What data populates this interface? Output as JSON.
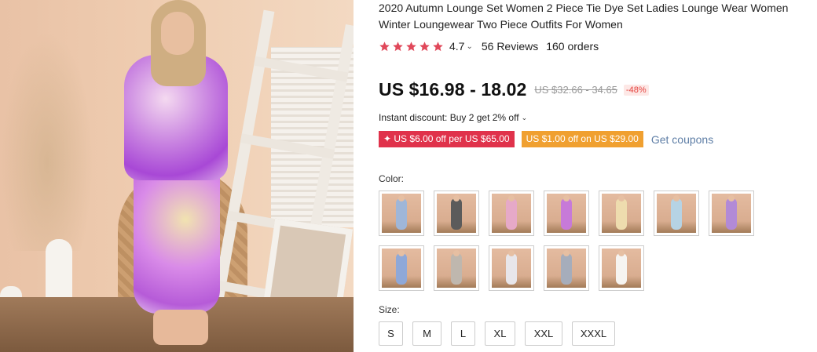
{
  "product": {
    "title": "2020 Autumn Lounge Set Women 2 Piece Tie Dye Set Ladies Lounge Wear Women Winter Loungewear Two Piece Outfits For Women"
  },
  "rating": {
    "stars": 5,
    "value": "4.7",
    "chevron": "⌄",
    "reviews": "56 Reviews",
    "orders": "160 orders",
    "star_color": "#e0485a"
  },
  "price": {
    "current": "US $16.98 - 18.02",
    "original": "US $32.66 - 34.65",
    "discount": "-48%"
  },
  "promo": {
    "instant_discount": "Instant discount: Buy 2 get 2% off",
    "chevron": "⌄",
    "coupons": [
      {
        "label": "✦ US $6.00 off per US $65.00",
        "color": "#e0324b"
      },
      {
        "label": "US $1.00 off on US $29.00",
        "color": "#f0a030"
      }
    ],
    "get_coupons": "Get coupons"
  },
  "color": {
    "label": "Color:",
    "swatches": [
      {
        "name": "blue-tie-dye",
        "outfit_color": "#9fb6d8"
      },
      {
        "name": "black-white-print",
        "outfit_color": "#5b5b5b"
      },
      {
        "name": "pink-tie-dye",
        "outfit_color": "#e6a9c8"
      },
      {
        "name": "purple-tie-dye",
        "outfit_color": "#c77ad8"
      },
      {
        "name": "cream-tie-dye",
        "outfit_color": "#eedcae"
      },
      {
        "name": "light-blue-tie-dye",
        "outfit_color": "#b6d3e4"
      },
      {
        "name": "violet-tie-dye",
        "outfit_color": "#b28ad6"
      },
      {
        "name": "multicolor-tie-dye",
        "outfit_color": "#8fa8d8"
      },
      {
        "name": "grey-leopard",
        "outfit_color": "#bfb7ae"
      },
      {
        "name": "white-floral",
        "outfit_color": "#e8e6ea"
      },
      {
        "name": "grey-tie-dye",
        "outfit_color": "#a6adbb"
      },
      {
        "name": "white",
        "outfit_color": "#f6f4f1"
      }
    ]
  },
  "size": {
    "label": "Size:",
    "options": [
      "S",
      "M",
      "L",
      "XL",
      "XXL",
      "XXXL"
    ]
  }
}
